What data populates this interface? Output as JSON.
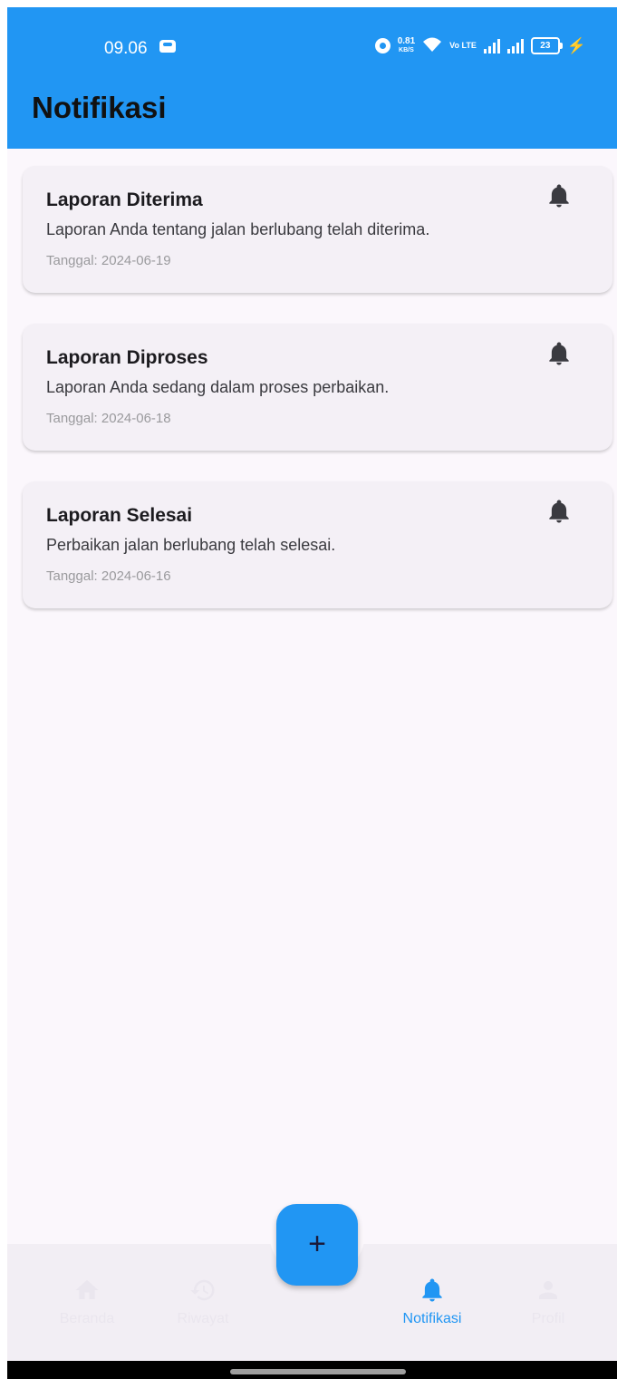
{
  "status_bar": {
    "time": "09.06",
    "net_speed_value": "0.81",
    "net_speed_unit": "KB/S",
    "volte": "Vo LTE",
    "battery": "23"
  },
  "app_bar": {
    "title": "Notifikasi",
    "color": "#2196f3"
  },
  "notifications": [
    {
      "title": "Laporan Diterima",
      "message": "Laporan Anda tentang jalan berlubang telah diterima.",
      "date": "Tanggal: 2024-06-19",
      "icon": "bell-icon"
    },
    {
      "title": "Laporan Diproses",
      "message": "Laporan Anda sedang dalam proses perbaikan.",
      "date": "Tanggal: 2024-06-18",
      "icon": "bell-icon"
    },
    {
      "title": "Laporan Selesai",
      "message": "Perbaikan jalan berlubang telah selesai.",
      "date": "Tanggal: 2024-06-16",
      "icon": "bell-icon"
    }
  ],
  "fab": {
    "label": "+",
    "icon": "plus-icon"
  },
  "bottom_nav": {
    "active": "Notifikasi",
    "items": [
      {
        "label": "Beranda",
        "icon": "home-icon"
      },
      {
        "label": "Riwayat",
        "icon": "history-icon"
      },
      {
        "label": "Notifikasi",
        "icon": "bell-icon"
      },
      {
        "label": "Profil",
        "icon": "person-icon"
      }
    ]
  }
}
